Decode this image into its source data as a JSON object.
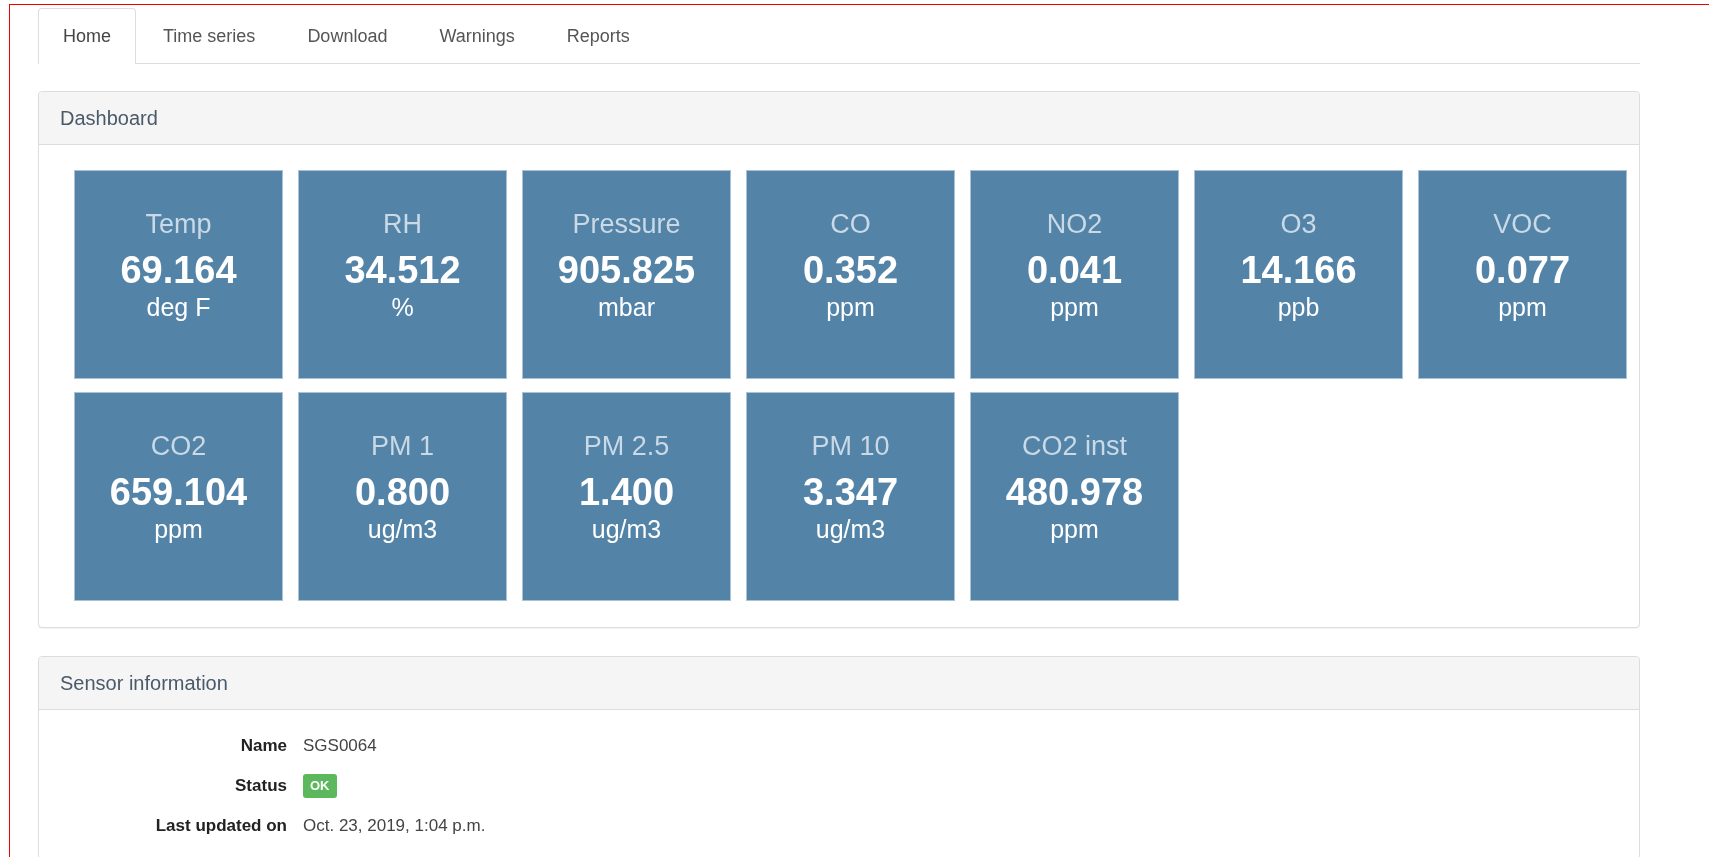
{
  "tabs": [
    {
      "label": "Home",
      "selected": true
    },
    {
      "label": "Time series",
      "selected": false
    },
    {
      "label": "Download",
      "selected": false
    },
    {
      "label": "Warnings",
      "selected": false
    },
    {
      "label": "Reports",
      "selected": false
    }
  ],
  "dashboard": {
    "title": "Dashboard",
    "tiles": [
      {
        "name": "Temp",
        "value": "69.164",
        "unit": "deg F"
      },
      {
        "name": "RH",
        "value": "34.512",
        "unit": "%"
      },
      {
        "name": "Pressure",
        "value": "905.825",
        "unit": "mbar"
      },
      {
        "name": "CO",
        "value": "0.352",
        "unit": "ppm"
      },
      {
        "name": "NO2",
        "value": "0.041",
        "unit": "ppm"
      },
      {
        "name": "O3",
        "value": "14.166",
        "unit": "ppb"
      },
      {
        "name": "VOC",
        "value": "0.077",
        "unit": "ppm"
      },
      {
        "name": "CO2",
        "value": "659.104",
        "unit": "ppm"
      },
      {
        "name": "PM 1",
        "value": "0.800",
        "unit": "ug/m3"
      },
      {
        "name": "PM 2.5",
        "value": "1.400",
        "unit": "ug/m3"
      },
      {
        "name": "PM 10",
        "value": "3.347",
        "unit": "ug/m3"
      },
      {
        "name": "CO2 inst",
        "value": "480.978",
        "unit": "ppm"
      }
    ]
  },
  "sensor_information": {
    "title": "Sensor information",
    "rows": [
      {
        "label": "Name",
        "value": "SGS0064",
        "kind": "text"
      },
      {
        "label": "Status",
        "value": "OK",
        "kind": "badge"
      },
      {
        "label": "Last updated on",
        "value": "Oct. 23, 2019, 1:04 p.m.",
        "kind": "text"
      }
    ]
  }
}
